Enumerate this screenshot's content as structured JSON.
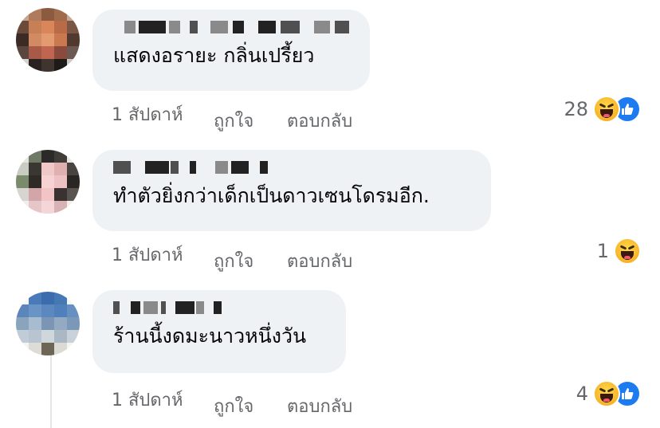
{
  "comments": [
    {
      "text": "แสดงอรายะ กลิ่นเปรี้ยว",
      "time": "1 สัปดาห์",
      "like_label": "ถูกใจ",
      "reply_label": "ตอบกลับ",
      "reaction_count": "28",
      "reactions": [
        "haha-emoji",
        "like-emoji"
      ]
    },
    {
      "text": "ทำตัวยิ่งกว่าเด็กเป็นดาวเซนโดรมอีก.",
      "time": "1 สัปดาห์",
      "like_label": "ถูกใจ",
      "reply_label": "ตอบกลับ",
      "reaction_count": "1",
      "reactions": [
        "haha-emoji"
      ]
    },
    {
      "text": "ร้านนี้งดมะนาวหนึ่งวัน",
      "time": "1 สัปดาห์",
      "like_label": "ถูกใจ",
      "reply_label": "ตอบกลับ",
      "reaction_count": "4",
      "reactions": [
        "haha-emoji",
        "like-emoji"
      ]
    }
  ],
  "colors": {
    "bubble": "#eff2f5",
    "meta_text": "#65676b",
    "like_blue": "#1d7bf2",
    "haha_yellow": "#f7b125"
  }
}
